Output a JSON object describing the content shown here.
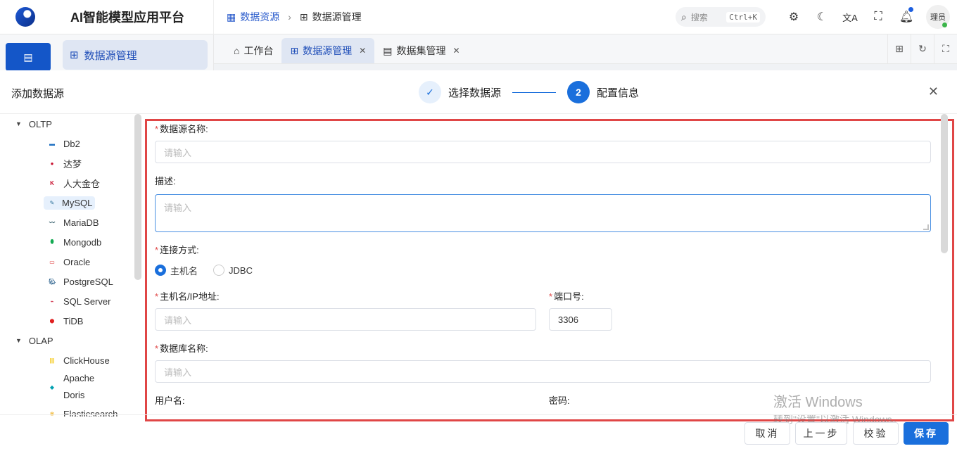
{
  "app": {
    "title": "AI智能模型应用平台"
  },
  "breadcrumb": {
    "root": "数据资源",
    "current": "数据源管理"
  },
  "header": {
    "search_placeholder": "搜索",
    "search_shortcut": "Ctrl+K",
    "user_name": "理员"
  },
  "subnav": {
    "active_label": "数据源管理"
  },
  "tabs": [
    {
      "label": "工作台"
    },
    {
      "label": "数据源管理"
    },
    {
      "label": "数据集管理"
    }
  ],
  "modal": {
    "title": "添加数据源",
    "steps": [
      {
        "label": "选择数据源",
        "index": "1"
      },
      {
        "label": "配置信息",
        "index": "2"
      }
    ]
  },
  "tree": {
    "group1": "OLTP",
    "group1_items": [
      "Db2",
      "达梦",
      "人大金仓",
      "MySQL",
      "MariaDB",
      "Mongodb",
      "Oracle",
      "PostgreSQL",
      "SQL Server",
      "TiDB"
    ],
    "group2": "OLAP",
    "group2_items": [
      "ClickHouse",
      "Apache Doris",
      "Elasticsearch"
    ]
  },
  "form": {
    "name_label": "数据源名称:",
    "name_placeholder": "请输入",
    "desc_label": "描述:",
    "desc_placeholder": "请输入",
    "conn_label": "连接方式:",
    "conn_options": [
      "主机名",
      "JDBC"
    ],
    "conn_selected": "主机名",
    "host_label": "主机名/IP地址:",
    "host_placeholder": "请输入",
    "port_label": "端口号:",
    "port_value": "3306",
    "dbname_label": "数据库名称:",
    "dbname_placeholder": "请输入",
    "user_label": "用户名:",
    "pwd_label": "密码:"
  },
  "footer": {
    "cancel": "取消",
    "prev": "上一步",
    "verify": "校验",
    "save": "保存"
  },
  "watermark": {
    "line1": "激活 Windows",
    "line2": "转到\"设置\"以激活 Windows。"
  },
  "colors": {
    "primary": "#1a6fdc",
    "highlight_border": "#e04646",
    "brand": "#1456c8"
  }
}
